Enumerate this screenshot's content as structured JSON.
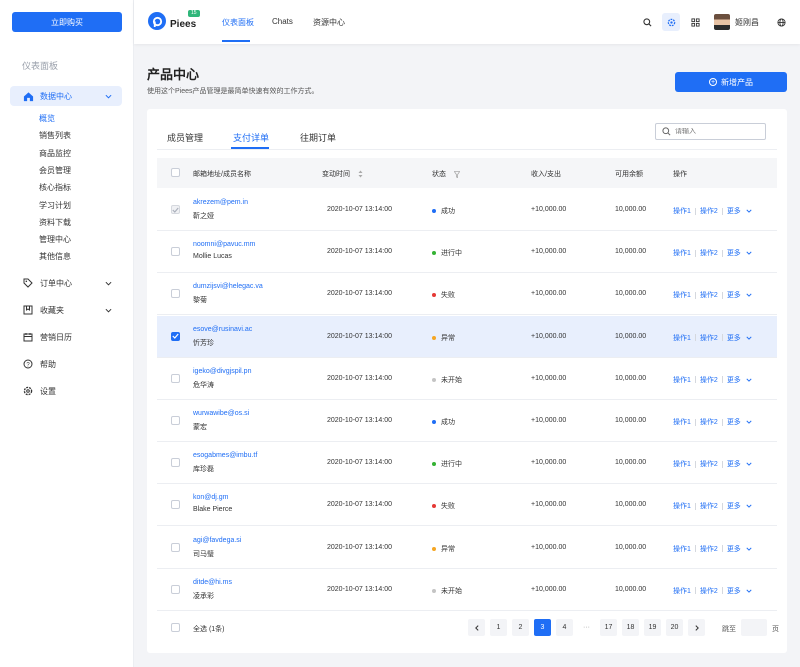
{
  "sidebar": {
    "buy_label": "立即购买",
    "section_title": "仪表面板",
    "data_center": {
      "label": "数据中心",
      "subitems": [
        {
          "label": "概览",
          "active": true
        },
        {
          "label": "销售列表",
          "active": false
        },
        {
          "label": "商品监控",
          "active": false
        },
        {
          "label": "会员管理",
          "active": false
        },
        {
          "label": "核心指标",
          "active": false
        },
        {
          "label": "学习计划",
          "active": false
        },
        {
          "label": "资料下载",
          "active": false
        },
        {
          "label": "管理中心",
          "active": false
        },
        {
          "label": "其他信息",
          "active": false
        }
      ]
    },
    "groups": [
      {
        "label": "订单中心",
        "icon": "tag-icon",
        "has_chevron": true
      },
      {
        "label": "收藏夹",
        "icon": "bookmark-icon",
        "has_chevron": true
      },
      {
        "label": "营销日历",
        "icon": "calendar-icon",
        "has_chevron": false
      },
      {
        "label": "帮助",
        "icon": "help-icon",
        "has_chevron": false
      },
      {
        "label": "设置",
        "icon": "settings-icon",
        "has_chevron": false
      }
    ]
  },
  "header": {
    "brand": "Piees",
    "brand_badge": "15",
    "nav": [
      {
        "label": "仪表面板",
        "active": true
      },
      {
        "label": "Chats",
        "active": false
      },
      {
        "label": "资源中心",
        "active": false
      }
    ],
    "user_name": "姬刚昌"
  },
  "page": {
    "title": "产品中心",
    "description": "使用这个Piees产品管理是最简单快速有效的工作方式。",
    "add_label": "新增产品"
  },
  "tabs": [
    {
      "label": "成员管理",
      "active": false
    },
    {
      "label": "支付详单",
      "active": true
    },
    {
      "label": "往期订单",
      "active": false
    }
  ],
  "search": {
    "placeholder": "请输入"
  },
  "table": {
    "headers": {
      "member": "邮箱地址/成员名称",
      "time": "变动时间",
      "status": "状态",
      "income": "收入/支出",
      "balance": "可用余额",
      "actions": "操作"
    },
    "action1": "操作1",
    "action2": "操作2",
    "more": "更多",
    "rows": [
      {
        "email": "akrezem@pem.in",
        "name": "靳之娅",
        "time": "2020-10-07  13:14:00",
        "status": "成功",
        "status_color": "#1f6ef5",
        "income": "+10,000.00",
        "balance": "10,000.00",
        "checkbox": "disabled"
      },
      {
        "email": "noomni@pavuc.mm",
        "name": "Mollie Lucas",
        "time": "2020-10-07  13:14:00",
        "status": "进行中",
        "status_color": "#34b233",
        "income": "+10,000.00",
        "balance": "10,000.00",
        "checkbox": "unchecked"
      },
      {
        "email": "dumzijsvi@helegac.va",
        "name": "黎菊",
        "time": "2020-10-07  13:14:00",
        "status": "失败",
        "status_color": "#e53935",
        "income": "+10,000.00",
        "balance": "10,000.00",
        "checkbox": "unchecked"
      },
      {
        "email": "esove@rusinavi.ac",
        "name": "忻芳珍",
        "time": "2020-10-07  13:14:00",
        "status": "异常",
        "status_color": "#f5a623",
        "income": "+10,000.00",
        "balance": "10,000.00",
        "checkbox": "checked"
      },
      {
        "email": "igeko@divgjspil.pn",
        "name": "危华涛",
        "time": "2020-10-07  13:14:00",
        "status": "未开始",
        "status_color": "#c4c4c4",
        "income": "+10,000.00",
        "balance": "10,000.00",
        "checkbox": "unchecked"
      },
      {
        "email": "wurwawibe@os.si",
        "name": "蒙宏",
        "time": "2020-10-07  13:14:00",
        "status": "成功",
        "status_color": "#1f6ef5",
        "income": "+10,000.00",
        "balance": "10,000.00",
        "checkbox": "unchecked"
      },
      {
        "email": "esogabmes@imbu.tf",
        "name": "库珍磊",
        "time": "2020-10-07  13:14:00",
        "status": "进行中",
        "status_color": "#34b233",
        "income": "+10,000.00",
        "balance": "10,000.00",
        "checkbox": "unchecked"
      },
      {
        "email": "kon@dj.gm",
        "name": "Blake Pierce",
        "time": "2020-10-07  13:14:00",
        "status": "失败",
        "status_color": "#e53935",
        "income": "+10,000.00",
        "balance": "10,000.00",
        "checkbox": "unchecked"
      },
      {
        "email": "agi@favdega.si",
        "name": "司马璧",
        "time": "2020-10-07  13:14:00",
        "status": "异常",
        "status_color": "#f5a623",
        "income": "+10,000.00",
        "balance": "10,000.00",
        "checkbox": "unchecked"
      },
      {
        "email": "ditde@hi.ms",
        "name": "凌承彩",
        "time": "2020-10-07  13:14:00",
        "status": "未开始",
        "status_color": "#c4c4c4",
        "income": "+10,000.00",
        "balance": "10,000.00",
        "checkbox": "unchecked"
      }
    ]
  },
  "footer": {
    "select_all": "全选 (1条)",
    "pages": [
      "1",
      "2",
      "3",
      "4",
      "···",
      "17",
      "18",
      "19",
      "20"
    ],
    "current_page": "3",
    "jump_label": "跳至",
    "page_unit": "页"
  }
}
